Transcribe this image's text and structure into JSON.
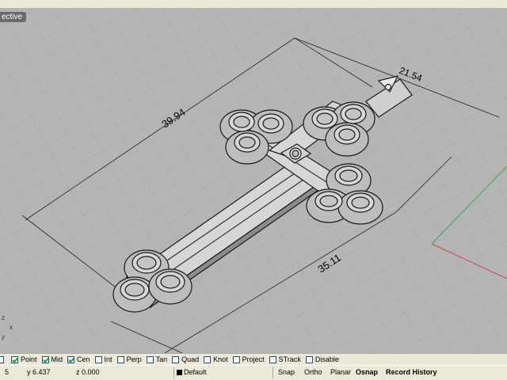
{
  "viewport": {
    "title": "ective",
    "dimensions": [
      "39.94",
      "21.54",
      "35.11"
    ],
    "axis_labels": [
      "x",
      "y",
      "z"
    ]
  },
  "osnap": [
    {
      "label": "",
      "checked": false
    },
    {
      "label": "Point",
      "checked": true
    },
    {
      "label": "Mid",
      "checked": true
    },
    {
      "label": "Cen",
      "checked": true
    },
    {
      "label": "Int",
      "checked": false
    },
    {
      "label": "Perp",
      "checked": false
    },
    {
      "label": "Tan",
      "checked": false
    },
    {
      "label": "Quad",
      "checked": false
    },
    {
      "label": "Knot",
      "checked": false
    },
    {
      "label": "Project",
      "checked": false
    },
    {
      "label": "STrack",
      "checked": false
    },
    {
      "label": "Disable",
      "checked": false
    }
  ],
  "status": {
    "x": "5",
    "y": "y 6.437",
    "z": "z 0.000",
    "layer": "Default",
    "snap": "Snap",
    "ortho": "Ortho",
    "planar": "Planar",
    "osnap": "Osnap",
    "record_history": "Record History"
  },
  "colors": {
    "grid_bg": "#b5b5b5",
    "grid_line": "#9f9f9f",
    "axis_red": "#c0504d",
    "axis_green": "#34a853",
    "model_fill": "#d6d6d6",
    "model_stroke": "#1a1a1a"
  }
}
